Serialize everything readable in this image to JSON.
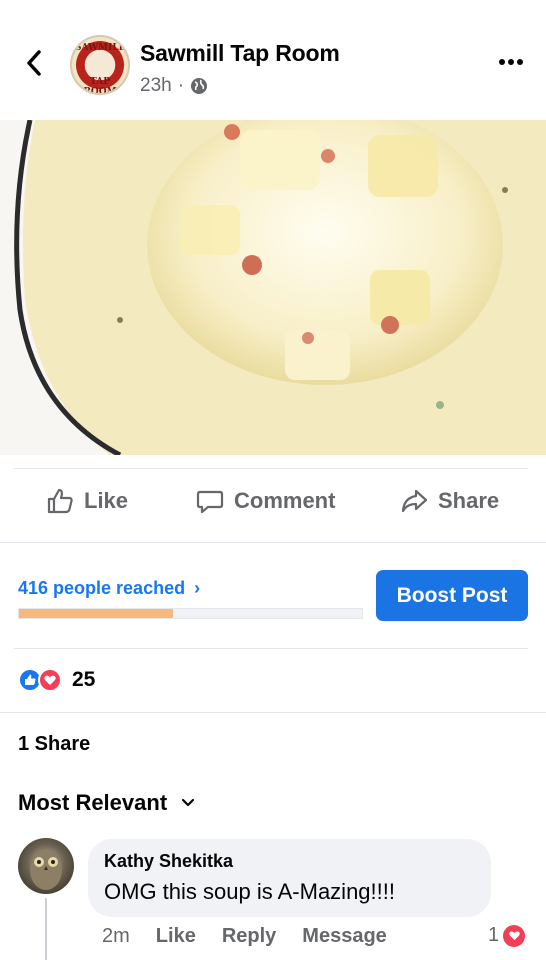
{
  "header": {
    "page_name": "Sawmill Tap Room",
    "time": "23h",
    "separator": "·",
    "logo_text_top": "SAWMILL",
    "logo_text_bottom": "TAP ROOM"
  },
  "actions": {
    "like": "Like",
    "comment": "Comment",
    "share": "Share"
  },
  "insights": {
    "reach_label": "416 people reached",
    "reach_chevron": "›",
    "reach_progress": 0.45,
    "boost_label": "Boost Post"
  },
  "reactions": {
    "count": "25"
  },
  "shares": {
    "label": "1 Share"
  },
  "comments": {
    "sort_label": "Most Relevant",
    "items": [
      {
        "author": "Kathy Shekitka",
        "text": "OMG this soup is A-Mazing!!!!",
        "time": "2m",
        "like": "Like",
        "reply": "Reply",
        "message": "Message",
        "reaction_count": "1"
      }
    ]
  },
  "colors": {
    "accent": "#1877f2",
    "boost": "#1b74e4",
    "progress": "#f6b97b",
    "love": "#f33e58"
  }
}
